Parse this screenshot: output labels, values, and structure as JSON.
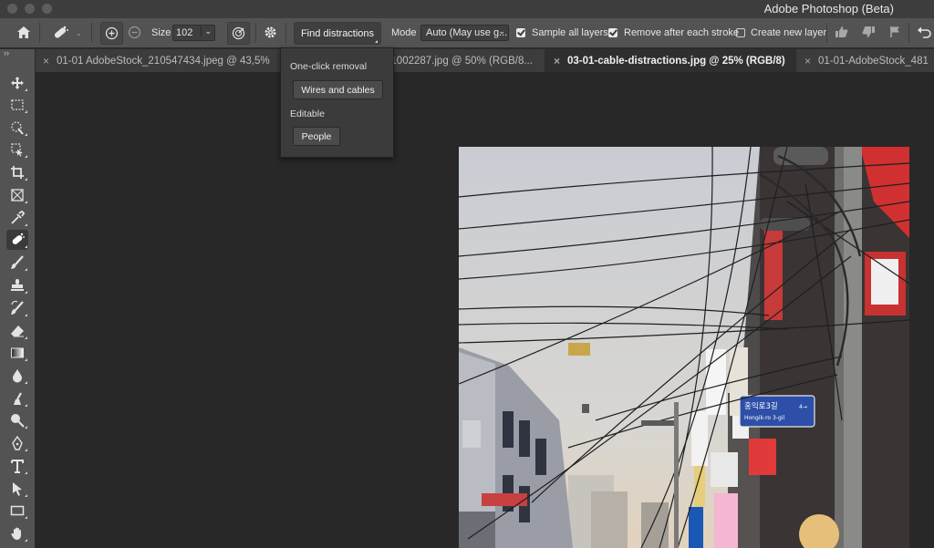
{
  "window": {
    "title": "Adobe Photoshop (Beta)"
  },
  "options_bar": {
    "size_label": "Size",
    "size_value": "102",
    "find_distractions": "Find distractions",
    "mode_label": "Mode",
    "mode_value": "Auto (May use g...",
    "sample_all_layers": "Sample all layers",
    "sample_all_layers_checked": true,
    "remove_after_stroke": "Remove after each stroke",
    "remove_after_stroke_checked": true,
    "create_new_layer": "Create new layer",
    "create_new_layer_checked": false
  },
  "tabs": [
    {
      "label": "01-01 AdobeStock_210547434.jpeg @ 43,5%",
      "active": false
    },
    {
      "label": "L1002287.jpg @ 50% (RGB/8...",
      "active": false
    },
    {
      "label": "03-01-cable-distractions.jpg @ 25% (RGB/8)",
      "active": true
    },
    {
      "label": "01-01-AdobeStock_481",
      "active": false
    }
  ],
  "popup": {
    "section1": "One-click removal",
    "wires_button": "Wires and cables",
    "section2": "Editable",
    "people_button": "People"
  },
  "tools": [
    "move-tool-icon",
    "marquee-tool-icon",
    "quick-selection-tool-icon",
    "object-selection-tool-icon",
    "crop-tool-icon",
    "frame-tool-icon",
    "eyedropper-tool-icon",
    "remove-tool-icon",
    "brush-tool-icon",
    "clone-stamp-tool-icon",
    "history-brush-tool-icon",
    "eraser-tool-icon",
    "gradient-tool-icon",
    "blur-tool-icon",
    "smudge-tool-icon",
    "dodge-tool-icon",
    "pen-tool-icon",
    "type-tool-icon",
    "path-selection-tool-icon",
    "rectangle-tool-icon",
    "hand-tool-icon"
  ],
  "sign": {
    "korean": "홍익로3길",
    "roman": "Hongik-ro 3-gil",
    "number": "4→"
  },
  "colors": {
    "accent_sign": "#2d4fa8",
    "ui_bar": "#535353",
    "canvas_bg": "#282828"
  }
}
